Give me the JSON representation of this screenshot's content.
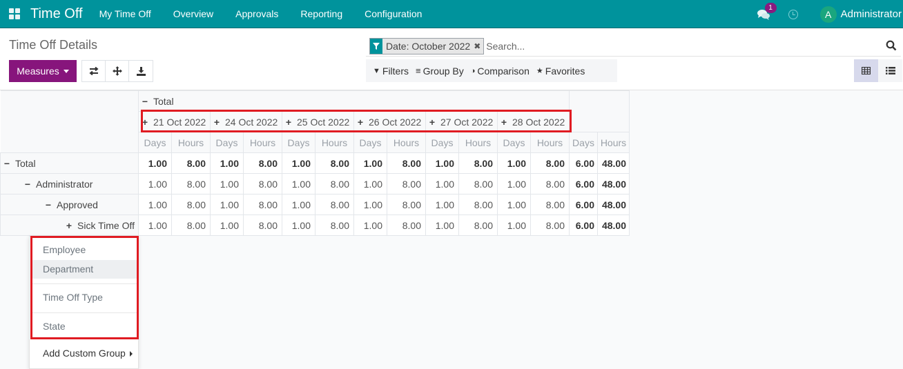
{
  "navbar": {
    "app_title": "Time Off",
    "menu": [
      "My Time Off",
      "Overview",
      "Approvals",
      "Reporting",
      "Configuration"
    ],
    "chat_badge": "1",
    "avatar_letter": "A",
    "user_name": "Administrator",
    "colors": {
      "bar": "#00939c",
      "badge": "#8a1a7f",
      "avatar": "#1aa67e"
    }
  },
  "control_panel": {
    "page_title": "Time Off Details",
    "measures_label": "Measures",
    "tools": [
      "flip-axis",
      "expand-all",
      "download"
    ],
    "search": {
      "facet_value": "Date: October 2022",
      "placeholder": "Search..."
    },
    "filter_bar": {
      "filters": "Filters",
      "group_by": "Group By",
      "comparison": "Comparison",
      "favorites": "Favorites"
    },
    "views": [
      "pivot",
      "list"
    ],
    "active_view": "pivot",
    "accent_color": "#87157c"
  },
  "pivot": {
    "col_total_label": "Total",
    "dates": [
      "21 Oct 2022",
      "24 Oct 2022",
      "25 Oct 2022",
      "26 Oct 2022",
      "27 Oct 2022",
      "28 Oct 2022"
    ],
    "measures": [
      "Days",
      "Hours"
    ],
    "rows": [
      {
        "label": "Total",
        "toggle": "minus",
        "level": 0,
        "bold": true,
        "values": [
          "1.00",
          "8.00",
          "1.00",
          "8.00",
          "1.00",
          "8.00",
          "1.00",
          "8.00",
          "1.00",
          "8.00",
          "1.00",
          "8.00"
        ],
        "totals": [
          "6.00",
          "48.00"
        ]
      },
      {
        "label": "Administrator",
        "toggle": "minus",
        "level": 1,
        "bold": false,
        "values": [
          "1.00",
          "8.00",
          "1.00",
          "8.00",
          "1.00",
          "8.00",
          "1.00",
          "8.00",
          "1.00",
          "8.00",
          "1.00",
          "8.00"
        ],
        "totals": [
          "6.00",
          "48.00"
        ]
      },
      {
        "label": "Approved",
        "toggle": "minus",
        "level": 2,
        "bold": false,
        "values": [
          "1.00",
          "8.00",
          "1.00",
          "8.00",
          "1.00",
          "8.00",
          "1.00",
          "8.00",
          "1.00",
          "8.00",
          "1.00",
          "8.00"
        ],
        "totals": [
          "6.00",
          "48.00"
        ]
      },
      {
        "label": "Sick Time Off",
        "toggle": "plus",
        "level": 3,
        "bold": false,
        "values": [
          "1.00",
          "8.00",
          "1.00",
          "8.00",
          "1.00",
          "8.00",
          "1.00",
          "8.00",
          "1.00",
          "8.00",
          "1.00",
          "8.00"
        ],
        "totals": [
          "6.00",
          "48.00"
        ]
      }
    ]
  },
  "groupby_dropdown": {
    "items": [
      "Employee",
      "Department",
      "Time Off Type",
      "State"
    ],
    "hovered": "Department",
    "custom_label": "Add Custom Group"
  }
}
